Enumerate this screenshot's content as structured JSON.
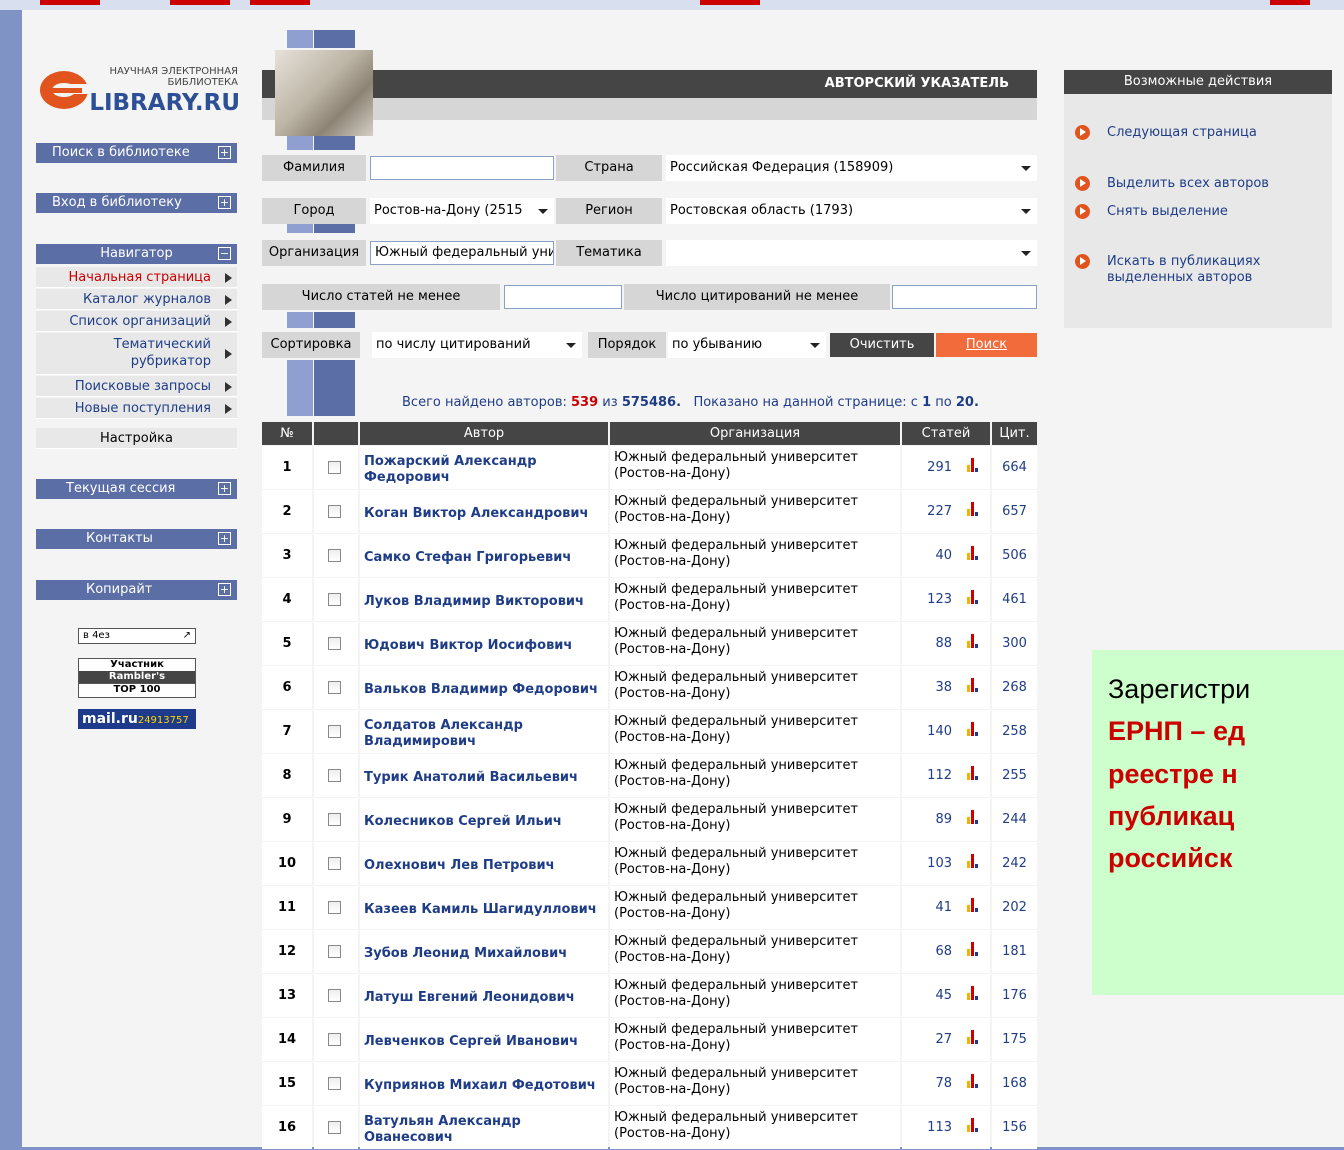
{
  "logo": {
    "small_line1": "НАУЧНАЯ ЭЛЕКТРОННАЯ",
    "small_line2": "БИБЛИОТЕКА",
    "big": "LIBRARY.RU"
  },
  "left_nav": {
    "search_library": "Поиск в библиотеке",
    "login_library": "Вход в библиотеку",
    "navigator": "Навигатор",
    "links": [
      {
        "label": "Начальная страница",
        "active": true
      },
      {
        "label": "Каталог журналов"
      },
      {
        "label": "Список организаций"
      },
      {
        "label": "Тематический рубрикатор"
      },
      {
        "label": "Поисковые запросы"
      },
      {
        "label": "Новые поступления"
      }
    ],
    "settings": "Настройка",
    "current_session": "Текущая сессия",
    "contacts": "Контакты",
    "copyright": "Копирайт",
    "counter1": "в 4ез",
    "counter2_line1": "Участник",
    "counter2_line2": "Rambler's",
    "counter2_line3": "TOP 100",
    "counter3_brand": "mail.ru",
    "counter3_num": "24913757"
  },
  "header": {
    "title": "АВТОРСКИЙ УКАЗАТЕЛЬ"
  },
  "form": {
    "surname_label": "Фамилия",
    "surname_value": "",
    "country_label": "Страна",
    "country_value": "Российская Федерация  (158909)",
    "city_label": "Город",
    "city_value": "Ростов-на-Дону  (2515",
    "region_label": "Регион",
    "region_value": "Ростовская область  (1793)",
    "org_label": "Организация",
    "org_value": "Южный федеральный унив",
    "topic_label": "Тематика",
    "topic_value": "",
    "min_articles_label": "Число статей не менее",
    "min_articles_value": "",
    "min_citations_label": "Число цитирований не менее",
    "min_citations_value": "",
    "sort_label": "Сортировка",
    "sort_value": "по числу цитирований",
    "order_label": "Порядок",
    "order_value": "по убыванию",
    "clear_button": "Очистить",
    "search_button": "Поиск"
  },
  "summary": {
    "prefix": "Всего найдено авторов:",
    "found": "539",
    "of": "из",
    "total": "575486.",
    "shown_prefix": "Показано на данной странице: с",
    "from": "1",
    "to_word": "по",
    "to": "20."
  },
  "table": {
    "headers": [
      "№",
      "",
      "Автор",
      "Организация",
      "Статей",
      "Цит."
    ],
    "org_line1": "Южный федеральный университет",
    "org_line2": "(Ростов-на-Дону)",
    "rows": [
      {
        "n": "1",
        "author": "Пожарский Александр Федорович",
        "articles": "291",
        "cit": "664"
      },
      {
        "n": "2",
        "author": "Коган Виктор Александрович",
        "articles": "227",
        "cit": "657"
      },
      {
        "n": "3",
        "author": "Самко Стефан Григорьевич",
        "articles": "40",
        "cit": "506"
      },
      {
        "n": "4",
        "author": "Луков Владимир Викторович",
        "articles": "123",
        "cit": "461"
      },
      {
        "n": "5",
        "author": "Юдович Виктор Иосифович",
        "articles": "88",
        "cit": "300"
      },
      {
        "n": "6",
        "author": "Вальков Владимир Федорович",
        "articles": "38",
        "cit": "268"
      },
      {
        "n": "7",
        "author": "Солдатов Александр Владимирович",
        "articles": "140",
        "cit": "258"
      },
      {
        "n": "8",
        "author": "Турик Анатолий Васильевич",
        "articles": "112",
        "cit": "255"
      },
      {
        "n": "9",
        "author": "Колесников Сергей Ильич",
        "articles": "89",
        "cit": "244"
      },
      {
        "n": "10",
        "author": "Олехнович Лев Петрович",
        "articles": "103",
        "cit": "242"
      },
      {
        "n": "11",
        "author": "Казеев Камиль Шагидуллович",
        "articles": "41",
        "cit": "202"
      },
      {
        "n": "12",
        "author": "Зубов Леонид Михайлович",
        "articles": "68",
        "cit": "181"
      },
      {
        "n": "13",
        "author": "Латуш Евгений Леонидович",
        "articles": "45",
        "cit": "176"
      },
      {
        "n": "14",
        "author": "Левченков Сергей Иванович",
        "articles": "27",
        "cit": "175"
      },
      {
        "n": "15",
        "author": "Куприянов Михаил Федотович",
        "articles": "78",
        "cit": "168"
      },
      {
        "n": "16",
        "author": "Ватульян Александр Ованесович",
        "articles": "113",
        "cit": "156"
      }
    ]
  },
  "actions": {
    "header": "Возможные действия",
    "items": [
      "Следующая страница",
      "Выделить всех авторов",
      "Снять выделение",
      "Искать в публикациях выделенных авторов"
    ]
  },
  "overlay": {
    "line1": "Зарегистри",
    "line2": "ЕРНП – ед",
    "line3": "реестре н",
    "line4": "публикац",
    "line5": "российск"
  },
  "colors": {
    "nav_blue": "#5c6ea6",
    "dark_header": "#454545",
    "search_orange": "#f26b3a",
    "link_blue": "#1f3d87",
    "accent_red": "#cc0000",
    "overlay_green": "#ccffcc"
  }
}
